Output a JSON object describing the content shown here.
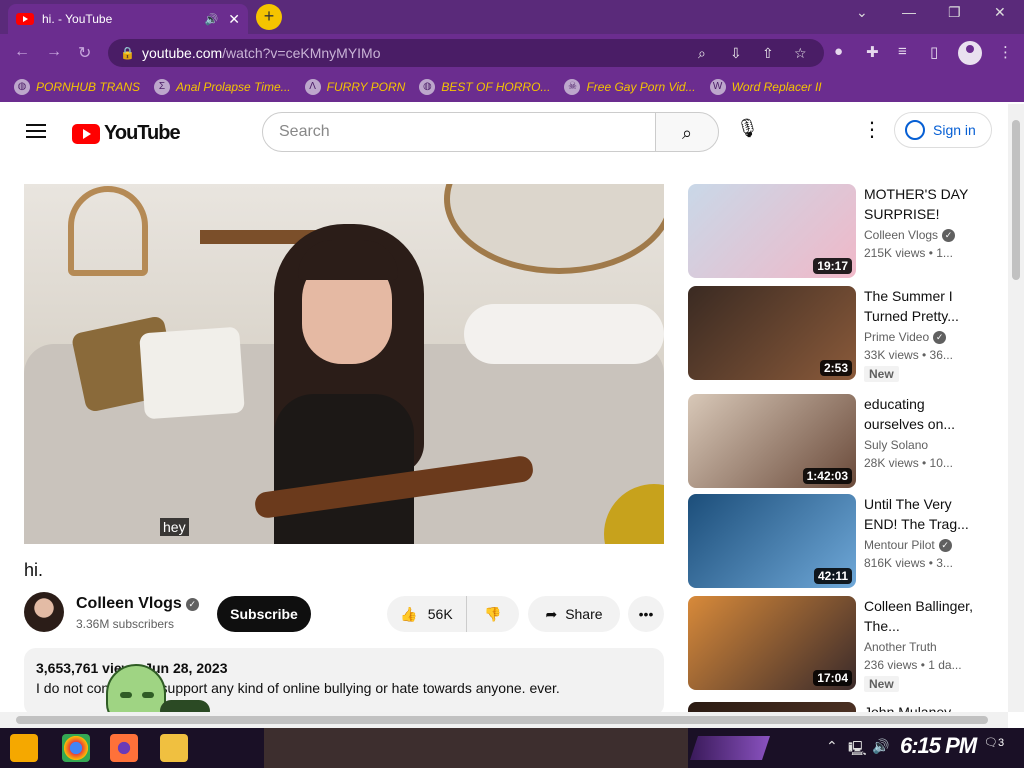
{
  "browser": {
    "tab_title": "hi. - YouTube",
    "tab_close": "✕",
    "new_tab": "+",
    "url_domain": "youtube.com",
    "url_path": "/watch?v=ceKMnyMYIMo",
    "window_controls": [
      "⌄",
      "—",
      "❐",
      "✕"
    ],
    "bookmarks": [
      {
        "label": "PORNHUB TRANS",
        "icon": "globe-icon"
      },
      {
        "label": "Anal Prolapse Time...",
        "icon": "sigma-icon"
      },
      {
        "label": "FURRY PORN",
        "icon": "lambda-icon"
      },
      {
        "label": "BEST OF HORRO...",
        "icon": "globe-icon"
      },
      {
        "label": "Free Gay Porn Vid...",
        "icon": "skull-icon"
      },
      {
        "label": "Word Replacer II",
        "icon": "wr-icon"
      }
    ]
  },
  "youtube": {
    "logo_text": "YouTube",
    "search_placeholder": "Search",
    "signin_label": "Sign in",
    "video": {
      "caption": "hey",
      "title": "hi.",
      "channel": "Colleen Vlogs",
      "subscribers": "3.36M subscribers",
      "subscribe_label": "Subscribe",
      "likes": "56K",
      "share_label": "Share",
      "stats": "3,653,761 views  Jun 28, 2023",
      "description": "I do not condone or support any kind of online bullying or hate towards anyone. ever."
    },
    "recommendations": [
      {
        "title": "MOTHER'S DAY SURPRISE!",
        "channel": "Colleen Vlogs",
        "verified": true,
        "meta": "215K views • 1...",
        "duration": "19:17",
        "new": false,
        "thumb_colors": [
          "#c9d8e8",
          "#f0b8c8"
        ]
      },
      {
        "title": "The Summer I Turned Pretty...",
        "channel": "Prime Video",
        "verified": true,
        "meta": "33K views • 36...",
        "duration": "2:53",
        "new": true,
        "thumb_colors": [
          "#3a2a22",
          "#8a5a3a"
        ]
      },
      {
        "title": "educating ourselves on...",
        "channel": "Suly Solano",
        "verified": false,
        "meta": "28K views • 10...",
        "duration": "1:42:03",
        "new": false,
        "thumb_colors": [
          "#d8c8b8",
          "#6a4a3a"
        ]
      },
      {
        "title": "Until The Very END! The Trag...",
        "channel": "Mentour Pilot",
        "verified": true,
        "meta": "816K views • 3...",
        "duration": "42:11",
        "new": false,
        "thumb_colors": [
          "#1c4e7a",
          "#6fa8d8"
        ]
      },
      {
        "title": "Colleen Ballinger, The...",
        "channel": "Another Truth",
        "verified": false,
        "meta": "236 views • 1 da...",
        "duration": "17:04",
        "new": true,
        "thumb_colors": [
          "#d88a3a",
          "#3a2a2a"
        ]
      },
      {
        "title": "John Mulaney...",
        "channel": "",
        "verified": false,
        "meta": "",
        "duration": "",
        "new": false,
        "thumb_colors": [
          "#2a1a12",
          "#5a3a2a"
        ]
      }
    ],
    "new_label": "New"
  },
  "taskbar": {
    "clock": "6:15 PM",
    "notifications": "3"
  }
}
